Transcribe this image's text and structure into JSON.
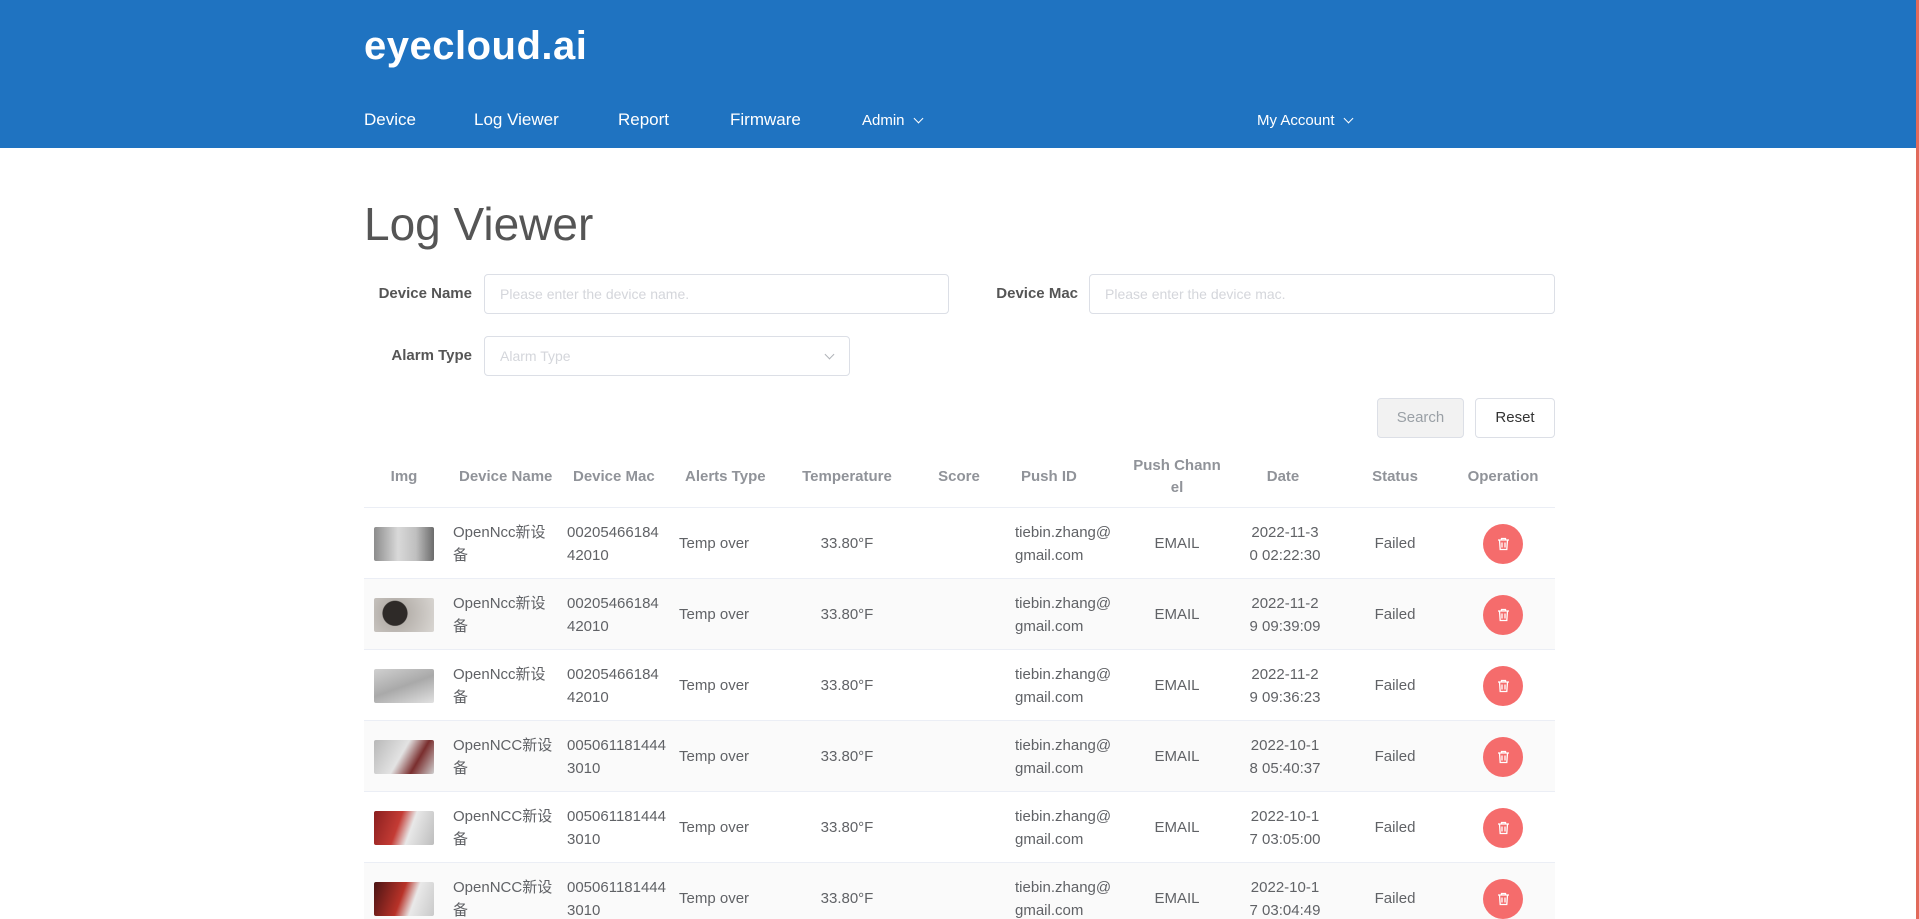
{
  "brand": "eyecloud.ai",
  "nav": {
    "device": "Device",
    "log_viewer": "Log Viewer",
    "report": "Report",
    "firmware": "Firmware",
    "admin": "Admin",
    "my_account": "My Account"
  },
  "page_title": "Log Viewer",
  "filters": {
    "device_name_label": "Device Name",
    "device_name_placeholder": "Please enter the device name.",
    "device_mac_label": "Device Mac",
    "device_mac_placeholder": "Please enter the device mac.",
    "alarm_type_label": "Alarm Type",
    "alarm_type_placeholder": "Alarm Type",
    "search_label": "Search",
    "reset_label": "Reset"
  },
  "table": {
    "headers": {
      "img": "Img",
      "device_name": "Device Name",
      "device_mac": "Device Mac",
      "alerts_type": "Alerts Type",
      "temperature": "Temperature",
      "score": "Score",
      "push_id": "Push ID",
      "push_channel": "Push Channel",
      "date": "Date",
      "status": "Status",
      "operation": "Operation"
    },
    "rows": [
      {
        "device_name": "OpenNcc新设备",
        "device_mac": "0020546618442010",
        "alerts_type": "Temp over",
        "temperature": "33.80°F",
        "score": "",
        "push_id": "tiebin.zhang@gmail.com",
        "push_channel": "EMAIL",
        "date": "2022-11-30 02:22:30",
        "status": "Failed"
      },
      {
        "device_name": "OpenNcc新设备",
        "device_mac": "0020546618442010",
        "alerts_type": "Temp over",
        "temperature": "33.80°F",
        "score": "",
        "push_id": "tiebin.zhang@gmail.com",
        "push_channel": "EMAIL",
        "date": "2022-11-29 09:39:09",
        "status": "Failed"
      },
      {
        "device_name": "OpenNcc新设备",
        "device_mac": "0020546618442010",
        "alerts_type": "Temp over",
        "temperature": "33.80°F",
        "score": "",
        "push_id": "tiebin.zhang@gmail.com",
        "push_channel": "EMAIL",
        "date": "2022-11-29 09:36:23",
        "status": "Failed"
      },
      {
        "device_name": "OpenNCC新设备",
        "device_mac": "0050611814443010",
        "alerts_type": "Temp over",
        "temperature": "33.80°F",
        "score": "",
        "push_id": "tiebin.zhang@gmail.com",
        "push_channel": "EMAIL",
        "date": "2022-10-18 05:40:37",
        "status": "Failed"
      },
      {
        "device_name": "OpenNCC新设备",
        "device_mac": "0050611814443010",
        "alerts_type": "Temp over",
        "temperature": "33.80°F",
        "score": "",
        "push_id": "tiebin.zhang@gmail.com",
        "push_channel": "EMAIL",
        "date": "2022-10-17 03:05:00",
        "status": "Failed"
      },
      {
        "device_name": "OpenNCC新设备",
        "device_mac": "0050611814443010",
        "alerts_type": "Temp over",
        "temperature": "33.80°F",
        "score": "",
        "push_id": "tiebin.zhang@gmail.com",
        "push_channel": "EMAIL",
        "date": "2022-10-17 03:04:49",
        "status": "Failed"
      }
    ]
  },
  "colors": {
    "header_bg": "#1f73c1",
    "delete_button": "#f56c6c"
  },
  "icons": {
    "operation": "trash-icon",
    "menu_caret": "chevron-down-icon"
  }
}
